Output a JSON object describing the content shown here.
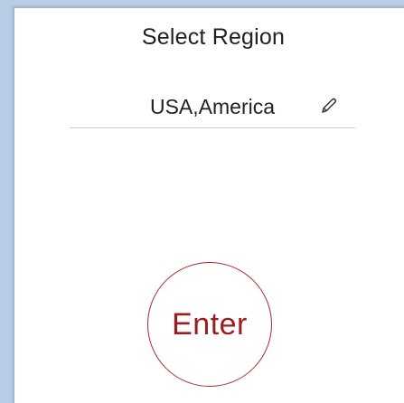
{
  "header": {
    "title": "Select Region"
  },
  "region": {
    "value": "USA,America",
    "edit_icon": "pencil-icon"
  },
  "actions": {
    "enter_label": "Enter"
  },
  "colors": {
    "accent": "#9e1b1b",
    "frame": "#b9cde6",
    "divider": "#cfcfcf"
  }
}
